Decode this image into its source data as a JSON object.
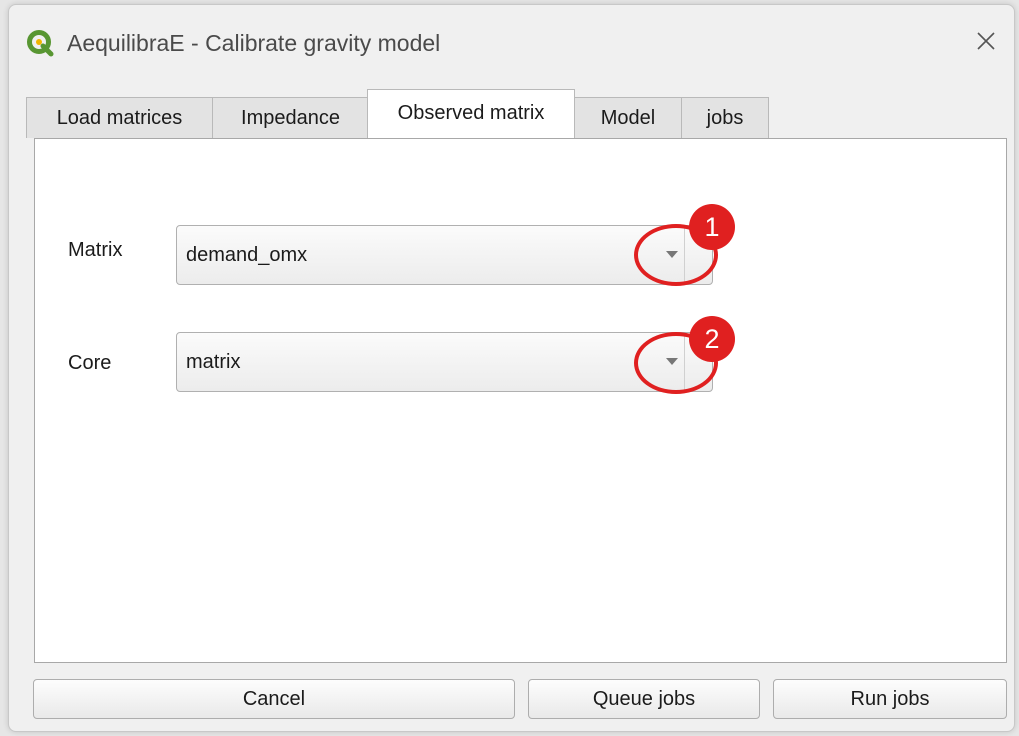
{
  "window": {
    "title": "AequilibraE - Calibrate gravity model",
    "app_icon": "qgis-logo-icon",
    "close_icon": "close-icon"
  },
  "tabs": [
    {
      "label": "Load matrices"
    },
    {
      "label": "Impedance"
    },
    {
      "label": "Observed matrix",
      "active": true
    },
    {
      "label": "Model"
    },
    {
      "label": "jobs"
    }
  ],
  "form": {
    "matrix_label": "Matrix",
    "matrix_value": "demand_omx",
    "core_label": "Core",
    "core_value": "matrix"
  },
  "annotations": {
    "first": "1",
    "second": "2",
    "color": "#e02020"
  },
  "buttons": {
    "cancel": "Cancel",
    "queue": "Queue jobs",
    "run": "Run jobs"
  }
}
